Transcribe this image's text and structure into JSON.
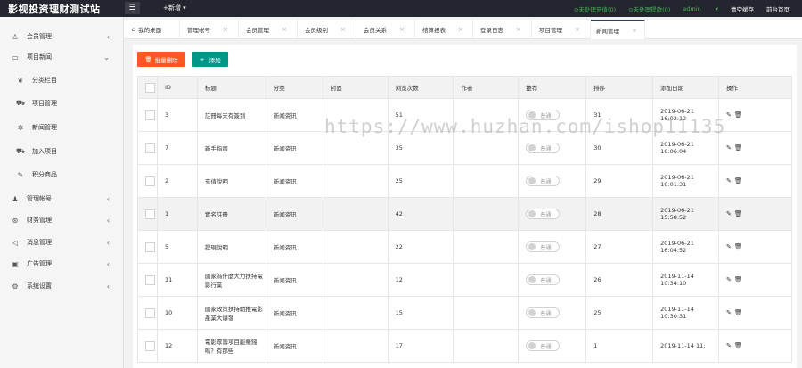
{
  "header": {
    "brand": "影视投资理财测试站",
    "menu_icon": "menu-icon",
    "add_new": "+新增",
    "pending_recharge": "⊙未处理充值(0)",
    "pending_withdraw": "⊙未处理提款(0)",
    "user": "admin",
    "clear_cache": "清空缓存",
    "front_home": "前台首页",
    "accent": "#3fb34f",
    "bar_color": "#23262e"
  },
  "sidebar": {
    "items": [
      {
        "label": "会员管理",
        "icon": "user-icon"
      },
      {
        "label": "项目新闻",
        "icon": "book-icon"
      },
      {
        "label": "分类栏目",
        "icon": "leaf-icon"
      },
      {
        "label": "项目管理",
        "icon": "cart-icon"
      },
      {
        "label": "新闻管理",
        "icon": "settings-icon"
      },
      {
        "label": "加入项目",
        "icon": "cart-icon"
      },
      {
        "label": "积分商品",
        "icon": "edit-icon"
      },
      {
        "label": "管理帐号",
        "icon": "user-group-icon"
      },
      {
        "label": "财务管理",
        "icon": "money-icon"
      },
      {
        "label": "消息管理",
        "icon": "bell-icon"
      },
      {
        "label": "广告管理",
        "icon": "image-icon"
      },
      {
        "label": "系统设置",
        "icon": "gear-icon"
      }
    ]
  },
  "tabs": [
    "我的桌面",
    "管理帐号",
    "会员管理",
    "会员级别",
    "会员关系",
    "结算报表",
    "登录日志",
    "项目管理",
    "新闻管理"
  ],
  "toolbar": {
    "delete_label": "批量删除",
    "add_label": "添加",
    "delete_color": "#ff5722",
    "add_color": "#009688"
  },
  "watermark": "https://www.huzhan.com/ishop11135",
  "table": {
    "headers": [
      "",
      "ID",
      "标题",
      "分类",
      "封面",
      "浏览次数",
      "作者",
      "推荐",
      "排序",
      "添加日期",
      "操作"
    ],
    "rows": [
      {
        "id": "3",
        "title": "註冊每天有簽到",
        "cat": "新闻资讯",
        "views": "51",
        "switch": "普通",
        "sort": "31",
        "date": "2019-06-21 16:02:12"
      },
      {
        "id": "7",
        "title": "新手指南",
        "cat": "新闻资讯",
        "views": "35",
        "switch": "普通",
        "sort": "30",
        "date": "2019-06-21 16:06:04"
      },
      {
        "id": "2",
        "title": "充值說明",
        "cat": "新闻资讯",
        "views": "25",
        "switch": "普通",
        "sort": "29",
        "date": "2019-06-21 16:01:31"
      },
      {
        "id": "1",
        "title": "實名註冊",
        "cat": "新闻资讯",
        "views": "42",
        "switch": "普通",
        "sort": "28",
        "date": "2019-06-21 15:58:52"
      },
      {
        "id": "5",
        "title": "提現說明",
        "cat": "新闻资讯",
        "views": "22",
        "switch": "普通",
        "sort": "27",
        "date": "2019-06-21 16:04:52"
      },
      {
        "id": "11",
        "title": "國家為什麼大力扶持電影行業",
        "cat": "新闻资讯",
        "views": "12",
        "switch": "普通",
        "sort": "26",
        "date": "2019-11-14 10:34:10"
      },
      {
        "id": "10",
        "title": "國家政策扶持助推電影產業大爆發",
        "cat": "新闻资讯",
        "views": "15",
        "switch": "普通",
        "sort": "25",
        "date": "2019-11-14 10:30:31"
      },
      {
        "id": "12",
        "title": "電影眾籌項目能賺錢嗎？有那些",
        "cat": "新闻资讯",
        "views": "17",
        "switch": "普通",
        "sort": "1",
        "date": "2019-11-14 11:"
      }
    ]
  }
}
